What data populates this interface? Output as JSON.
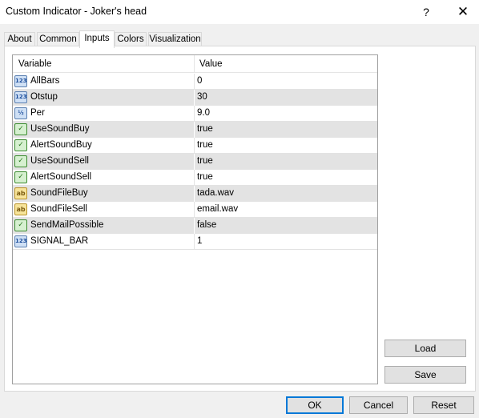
{
  "window": {
    "title": "Custom Indicator - Joker's head",
    "help_glyph": "?",
    "close_glyph": "✕"
  },
  "tabs": [
    {
      "label": "About"
    },
    {
      "label": "Common"
    },
    {
      "label": "Inputs",
      "active": true
    },
    {
      "label": "Colors"
    },
    {
      "label": "Visualization"
    }
  ],
  "grid": {
    "col_variable": "Variable",
    "col_value": "Value",
    "rows": [
      {
        "name": "AllBars",
        "value": "0",
        "type": "int",
        "icon_text": "123",
        "icon": "integer-icon"
      },
      {
        "name": "Otstup",
        "value": "30",
        "type": "int",
        "icon_text": "123",
        "icon": "integer-icon"
      },
      {
        "name": "Per",
        "value": "9.0",
        "type": "dbl",
        "icon_text": "½",
        "icon": "double-icon"
      },
      {
        "name": "UseSoundBuy",
        "value": "true",
        "type": "bool",
        "icon_text": "✓",
        "icon": "boolean-icon"
      },
      {
        "name": "AlertSoundBuy",
        "value": "true",
        "type": "bool",
        "icon_text": "✓",
        "icon": "boolean-icon"
      },
      {
        "name": "UseSoundSell",
        "value": "true",
        "type": "bool",
        "icon_text": "✓",
        "icon": "boolean-icon"
      },
      {
        "name": "AlertSoundSell",
        "value": "true",
        "type": "bool",
        "icon_text": "✓",
        "icon": "boolean-icon"
      },
      {
        "name": "SoundFileBuy",
        "value": "tada.wav",
        "type": "str",
        "icon_text": "ab",
        "icon": "string-icon"
      },
      {
        "name": "SoundFileSell",
        "value": "email.wav",
        "type": "str",
        "icon_text": "ab",
        "icon": "string-icon"
      },
      {
        "name": "SendMailPossible",
        "value": "false",
        "type": "bool",
        "icon_text": "✓",
        "icon": "boolean-icon"
      },
      {
        "name": "SIGNAL_BAR",
        "value": "1",
        "type": "int",
        "icon_text": "123",
        "icon": "integer-icon"
      }
    ]
  },
  "buttons": {
    "load": "Load",
    "save": "Save",
    "ok": "OK",
    "cancel": "Cancel",
    "reset": "Reset"
  },
  "colors": {
    "accent": "#0078d7",
    "row_alt": "#e3e3e3"
  }
}
